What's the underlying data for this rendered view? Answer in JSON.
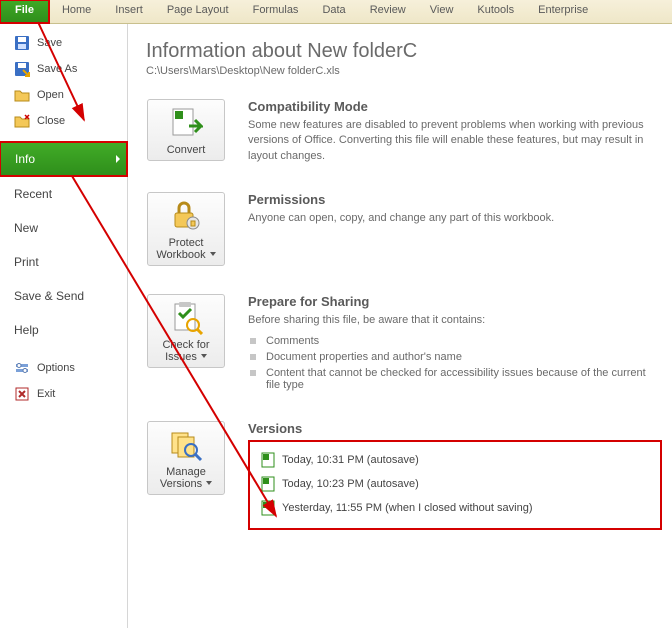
{
  "ribbon": {
    "tabs": [
      "File",
      "Home",
      "Insert",
      "Page Layout",
      "Formulas",
      "Data",
      "Review",
      "View",
      "Kutools",
      "Enterprise"
    ]
  },
  "side": {
    "save": "Save",
    "save_as": "Save As",
    "open": "Open",
    "close": "Close",
    "info": "Info",
    "recent": "Recent",
    "new": "New",
    "print": "Print",
    "save_send": "Save & Send",
    "help": "Help",
    "options": "Options",
    "exit": "Exit"
  },
  "title": "Information about New folderC",
  "path": "C:\\Users\\Mars\\Desktop\\New folderC.xls",
  "convert": {
    "btn": "Convert",
    "head": "Compatibility Mode",
    "body": "Some new features are disabled to prevent problems when working with previous versions of Office. Converting this file will enable these features, but may result in layout changes."
  },
  "protect": {
    "btn": "Protect Workbook",
    "head": "Permissions",
    "body": "Anyone can open, copy, and change any part of this workbook."
  },
  "check": {
    "btn": "Check for Issues",
    "head": "Prepare for Sharing",
    "lead": "Before sharing this file, be aware that it contains:",
    "items": [
      "Comments",
      "Document properties and author's name",
      "Content that cannot be checked for accessibility issues because of the current file type"
    ]
  },
  "versions": {
    "btn": "Manage Versions",
    "head": "Versions",
    "rows": [
      "Today, 10:31 PM (autosave)",
      "Today, 10:23 PM (autosave)",
      "Yesterday, 11:55 PM (when I closed without saving)"
    ]
  }
}
